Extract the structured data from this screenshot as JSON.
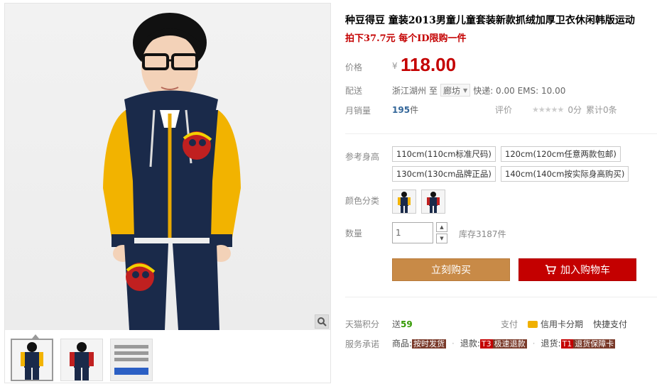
{
  "product": {
    "title": "种豆得豆 童装2013男童儿童套装新款抓绒加厚卫衣休闲韩版运动",
    "promo": "拍下37.7元 每个ID限购一件"
  },
  "price": {
    "label": "价格",
    "currency": "¥",
    "value": "118.00"
  },
  "shipping": {
    "label": "配送",
    "from": "浙江湖州",
    "to_word": "至",
    "to_city": "廊坊",
    "fee": "快递: 0.00 EMS: 10.00"
  },
  "sales": {
    "label": "月销量",
    "count": "195",
    "unit": "件",
    "rating_label": "评价",
    "score": "0分",
    "total": "累计0条"
  },
  "size": {
    "label": "参考身高",
    "options": [
      "110cm(110cm标准尺码)",
      "120cm(120cm任意两款包邮)",
      "130cm(130cm品牌正品)",
      "140cm(140cm按实际身高购买)"
    ]
  },
  "color": {
    "label": "颜色分类"
  },
  "quantity": {
    "label": "数量",
    "value": "1",
    "stock": "库存3187件"
  },
  "actions": {
    "buy_now": "立刻购买",
    "add_cart": "加入购物车"
  },
  "points": {
    "label": "天猫积分",
    "prefix": "送",
    "value": "59"
  },
  "payment": {
    "label": "支付",
    "credit": "信用卡分期",
    "quick": "快捷支付"
  },
  "promises": {
    "label": "服务承诺",
    "items": [
      {
        "prefix": "商品:",
        "tag": "按时发货"
      },
      {
        "prefix": "退款:",
        "code": "T3",
        "tag": "极速退款"
      },
      {
        "prefix": "退货:",
        "code": "T1",
        "tag": "退货保障卡"
      }
    ]
  },
  "colors": {
    "price_red": "#c40000",
    "buy_orange": "#c88a47",
    "jacket_navy": "#1a2a4a",
    "sleeve_yellow": "#f2b300"
  }
}
